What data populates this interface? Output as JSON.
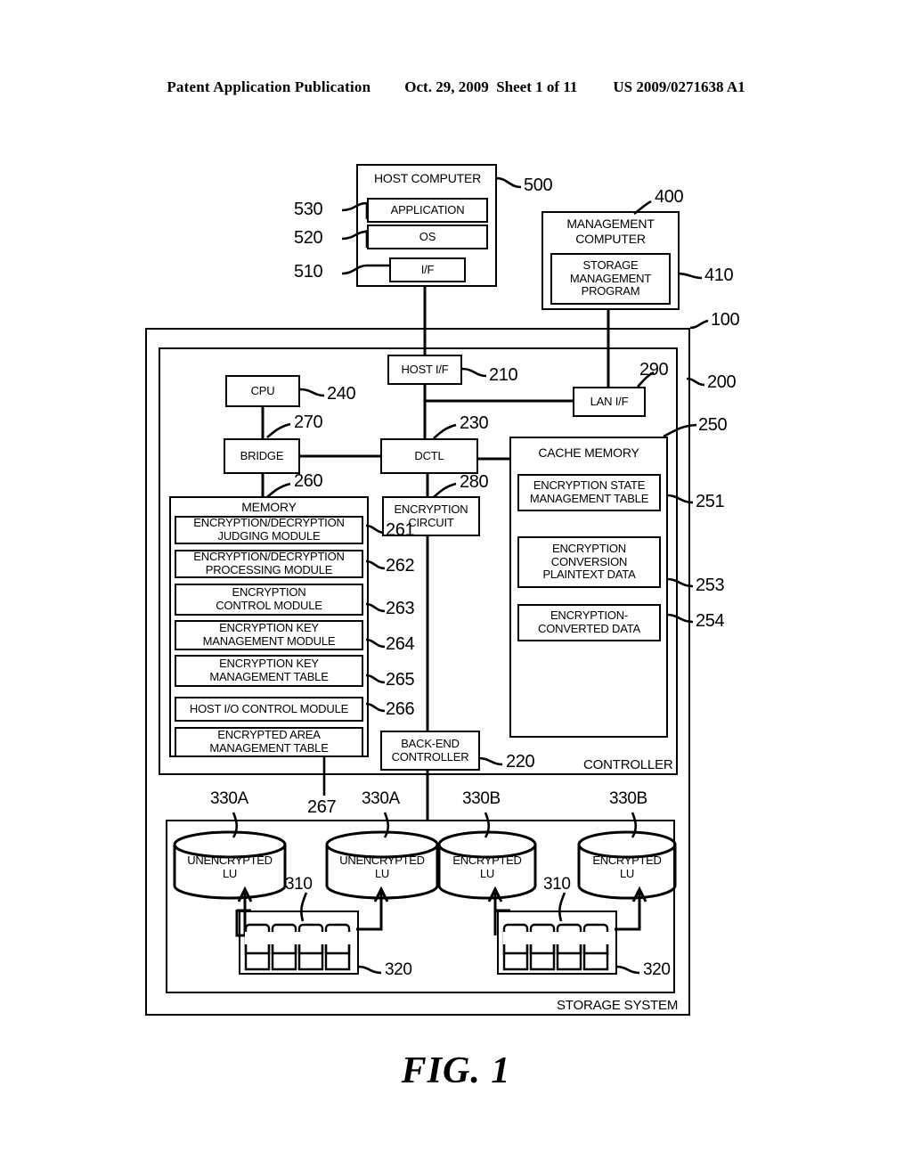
{
  "header": {
    "left": "Patent Application Publication",
    "date": "Oct. 29, 2009",
    "sheet": "Sheet 1 of 11",
    "pubnum": "US 2009/0271638 A1"
  },
  "figure_caption": "FIG. 1",
  "host": {
    "title": "HOST COMPUTER",
    "ref": "500",
    "application": {
      "label": "APPLICATION",
      "ref": "530"
    },
    "os": {
      "label": "OS",
      "ref": "520"
    },
    "interface": {
      "label": "I/F",
      "ref": "510"
    }
  },
  "management": {
    "title_line1": "MANAGEMENT",
    "title_line2": "COMPUTER",
    "ref": "400",
    "program": {
      "line1": "STORAGE",
      "line2": "MANAGEMENT",
      "line3": "PROGRAM",
      "ref": "410"
    }
  },
  "storage_system": {
    "label": "STORAGE SYSTEM",
    "ref": "100"
  },
  "controller": {
    "label": "CONTROLLER",
    "ref": "200",
    "host_if": {
      "label": "HOST I/F",
      "ref": "210"
    },
    "lan_if": {
      "label": "LAN I/F",
      "ref": "290"
    },
    "cpu": {
      "label": "CPU",
      "ref": "240"
    },
    "bridge": {
      "label": "BRIDGE",
      "ref": "270"
    },
    "dctl": {
      "label": "DCTL",
      "ref": "230"
    },
    "encryption_circuit": {
      "line1": "ENCRYPTION",
      "line2": "CIRCUIT",
      "ref": "280"
    },
    "backend_controller": {
      "line1": "BACK-END",
      "line2": "CONTROLLER",
      "ref": "220"
    }
  },
  "memory": {
    "title": "MEMORY",
    "ref": "260",
    "modules": [
      {
        "line1": "ENCRYPTION/DECRYPTION",
        "line2": "JUDGING MODULE",
        "ref": "261"
      },
      {
        "line1": "ENCRYPTION/DECRYPTION",
        "line2": "PROCESSING MODULE",
        "ref": "262"
      },
      {
        "line1": "ENCRYPTION",
        "line2": "CONTROL MODULE",
        "ref": "263"
      },
      {
        "line1": "ENCRYPTION KEY",
        "line2": "MANAGEMENT MODULE",
        "ref": "264"
      },
      {
        "line1": "ENCRYPTION KEY",
        "line2": "MANAGEMENT TABLE",
        "ref": "265"
      },
      {
        "line1": "HOST I/O CONTROL MODULE",
        "line2": "",
        "ref": "266"
      },
      {
        "line1": "ENCRYPTED AREA",
        "line2": "MANAGEMENT TABLE",
        "ref": "267"
      }
    ]
  },
  "cache_memory": {
    "title": "CACHE MEMORY",
    "ref": "250",
    "items": [
      {
        "line1": "ENCRYPTION STATE",
        "line2": "MANAGEMENT TABLE",
        "line3": "",
        "ref": "251"
      },
      {
        "line1": "ENCRYPTION",
        "line2": "CONVERSION",
        "line3": "PLAINTEXT DATA",
        "ref": "253"
      },
      {
        "line1": "ENCRYPTION-",
        "line2": "CONVERTED DATA",
        "line3": "",
        "ref": "254"
      }
    ]
  },
  "logical_units": [
    {
      "line1": "UNENCRYPTED",
      "line2": "LU",
      "ref": "330A"
    },
    {
      "line1": "UNENCRYPTED",
      "line2": "LU",
      "ref": "330A"
    },
    {
      "line1": "ENCRYPTED",
      "line2": "LU",
      "ref": "330B"
    },
    {
      "line1": "ENCRYPTED",
      "line2": "LU",
      "ref": "330B"
    }
  ],
  "disk_arrays": [
    {
      "disk_ref": "310",
      "array_ref": "320"
    },
    {
      "disk_ref": "310",
      "array_ref": "320"
    }
  ],
  "colors": {
    "ink": "#000000",
    "paper": "#ffffff"
  }
}
